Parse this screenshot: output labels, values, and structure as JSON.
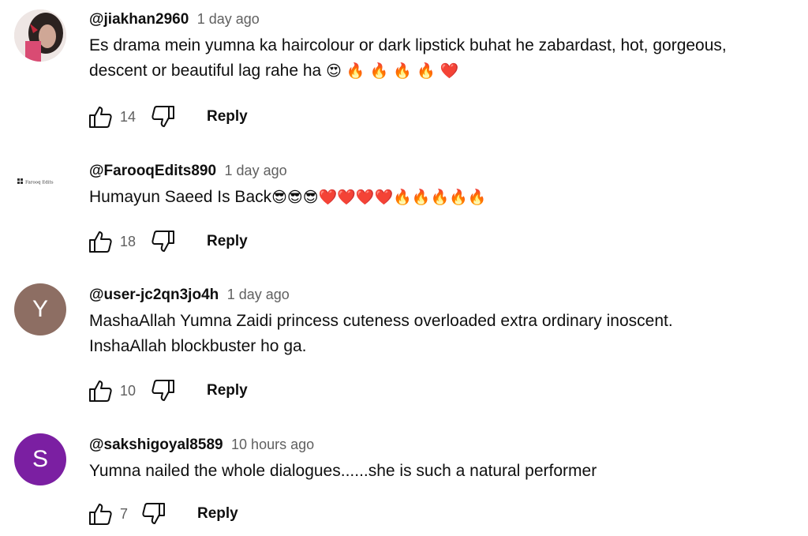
{
  "comments": [
    {
      "author": "@jiakhan2960",
      "time": "1 day ago",
      "text": "Es drama mein yumna ka haircolour or dark lipstick buhat he zabardast, hot, gorgeous,\ndescent or beautiful lag rahe ha",
      "emojis": "😍 🔥 🔥 🔥 🔥 ❤️",
      "likes": "14",
      "reply": "Reply",
      "avatar_icon": "photo-avatar",
      "avatar_color": "#d8c7c4"
    },
    {
      "author": "@FarooqEdits890",
      "time": "1 day ago",
      "text": "Humayun Saeed Is Back",
      "emojis": "😎😎😎❤️❤️❤️❤️🔥🔥🔥🔥🔥",
      "likes": "18",
      "reply": "Reply",
      "avatar_logo_text": "Farooq Edits",
      "avatar_color": "#ffffff"
    },
    {
      "author": "@user-jc2qn3jo4h",
      "time": "1 day ago",
      "text": "MashaAllah Yumna Zaidi princess cuteness overloaded extra ordinary inoscent.\nInshaAllah blockbuster ho ga.",
      "emojis": "",
      "likes": "10",
      "reply": "Reply",
      "avatar_letter": "Y",
      "avatar_color": "#8d6e63"
    },
    {
      "author": "@sakshigoyal8589",
      "time": "10 hours ago",
      "text": "Yumna nailed the whole dialogues......she is such a natural performer",
      "emojis": "",
      "likes": "7",
      "reply": "Reply",
      "avatar_letter": "S",
      "avatar_color": "#7b1fa2"
    }
  ]
}
